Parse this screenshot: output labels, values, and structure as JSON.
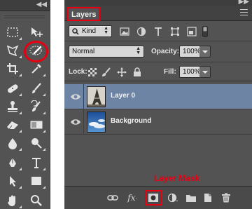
{
  "tools": {
    "icons": [
      "marquee-icon",
      "move-icon",
      "lasso-icon",
      "quick-selection-icon",
      "crop-icon",
      "eyedropper-icon",
      "healing-brush-icon",
      "brush-icon",
      "clone-stamp-icon",
      "history-brush-icon",
      "eraser-icon",
      "gradient-icon",
      "blur-icon",
      "dodge-icon",
      "pen-icon",
      "type-icon",
      "path-selection-icon",
      "rectangle-icon",
      "hand-icon",
      "zoom-icon"
    ],
    "highlighted": "quick-selection-icon"
  },
  "layers_panel": {
    "tab_label": "Layers",
    "filter": {
      "kind_label": "Kind"
    },
    "blend": {
      "mode": "Normal",
      "opacity_label": "Opacity:",
      "opacity_value": "100%"
    },
    "lock": {
      "label": "Lock:",
      "fill_label": "Fill:",
      "fill_value": "100%"
    },
    "layers": [
      {
        "name": "Layer 0",
        "selected": true,
        "visible": true
      },
      {
        "name": "Background",
        "selected": false,
        "visible": true
      }
    ],
    "annotation": "Layer Mask",
    "bottom_icons": [
      "link-icon",
      "fx-icon",
      "add-mask-icon",
      "adjustment-icon",
      "group-icon",
      "new-layer-icon",
      "trash-icon"
    ]
  },
  "colors": {
    "highlight": "#e60012",
    "selected_row": "#6e84a5",
    "panel_bg": "#535353"
  }
}
